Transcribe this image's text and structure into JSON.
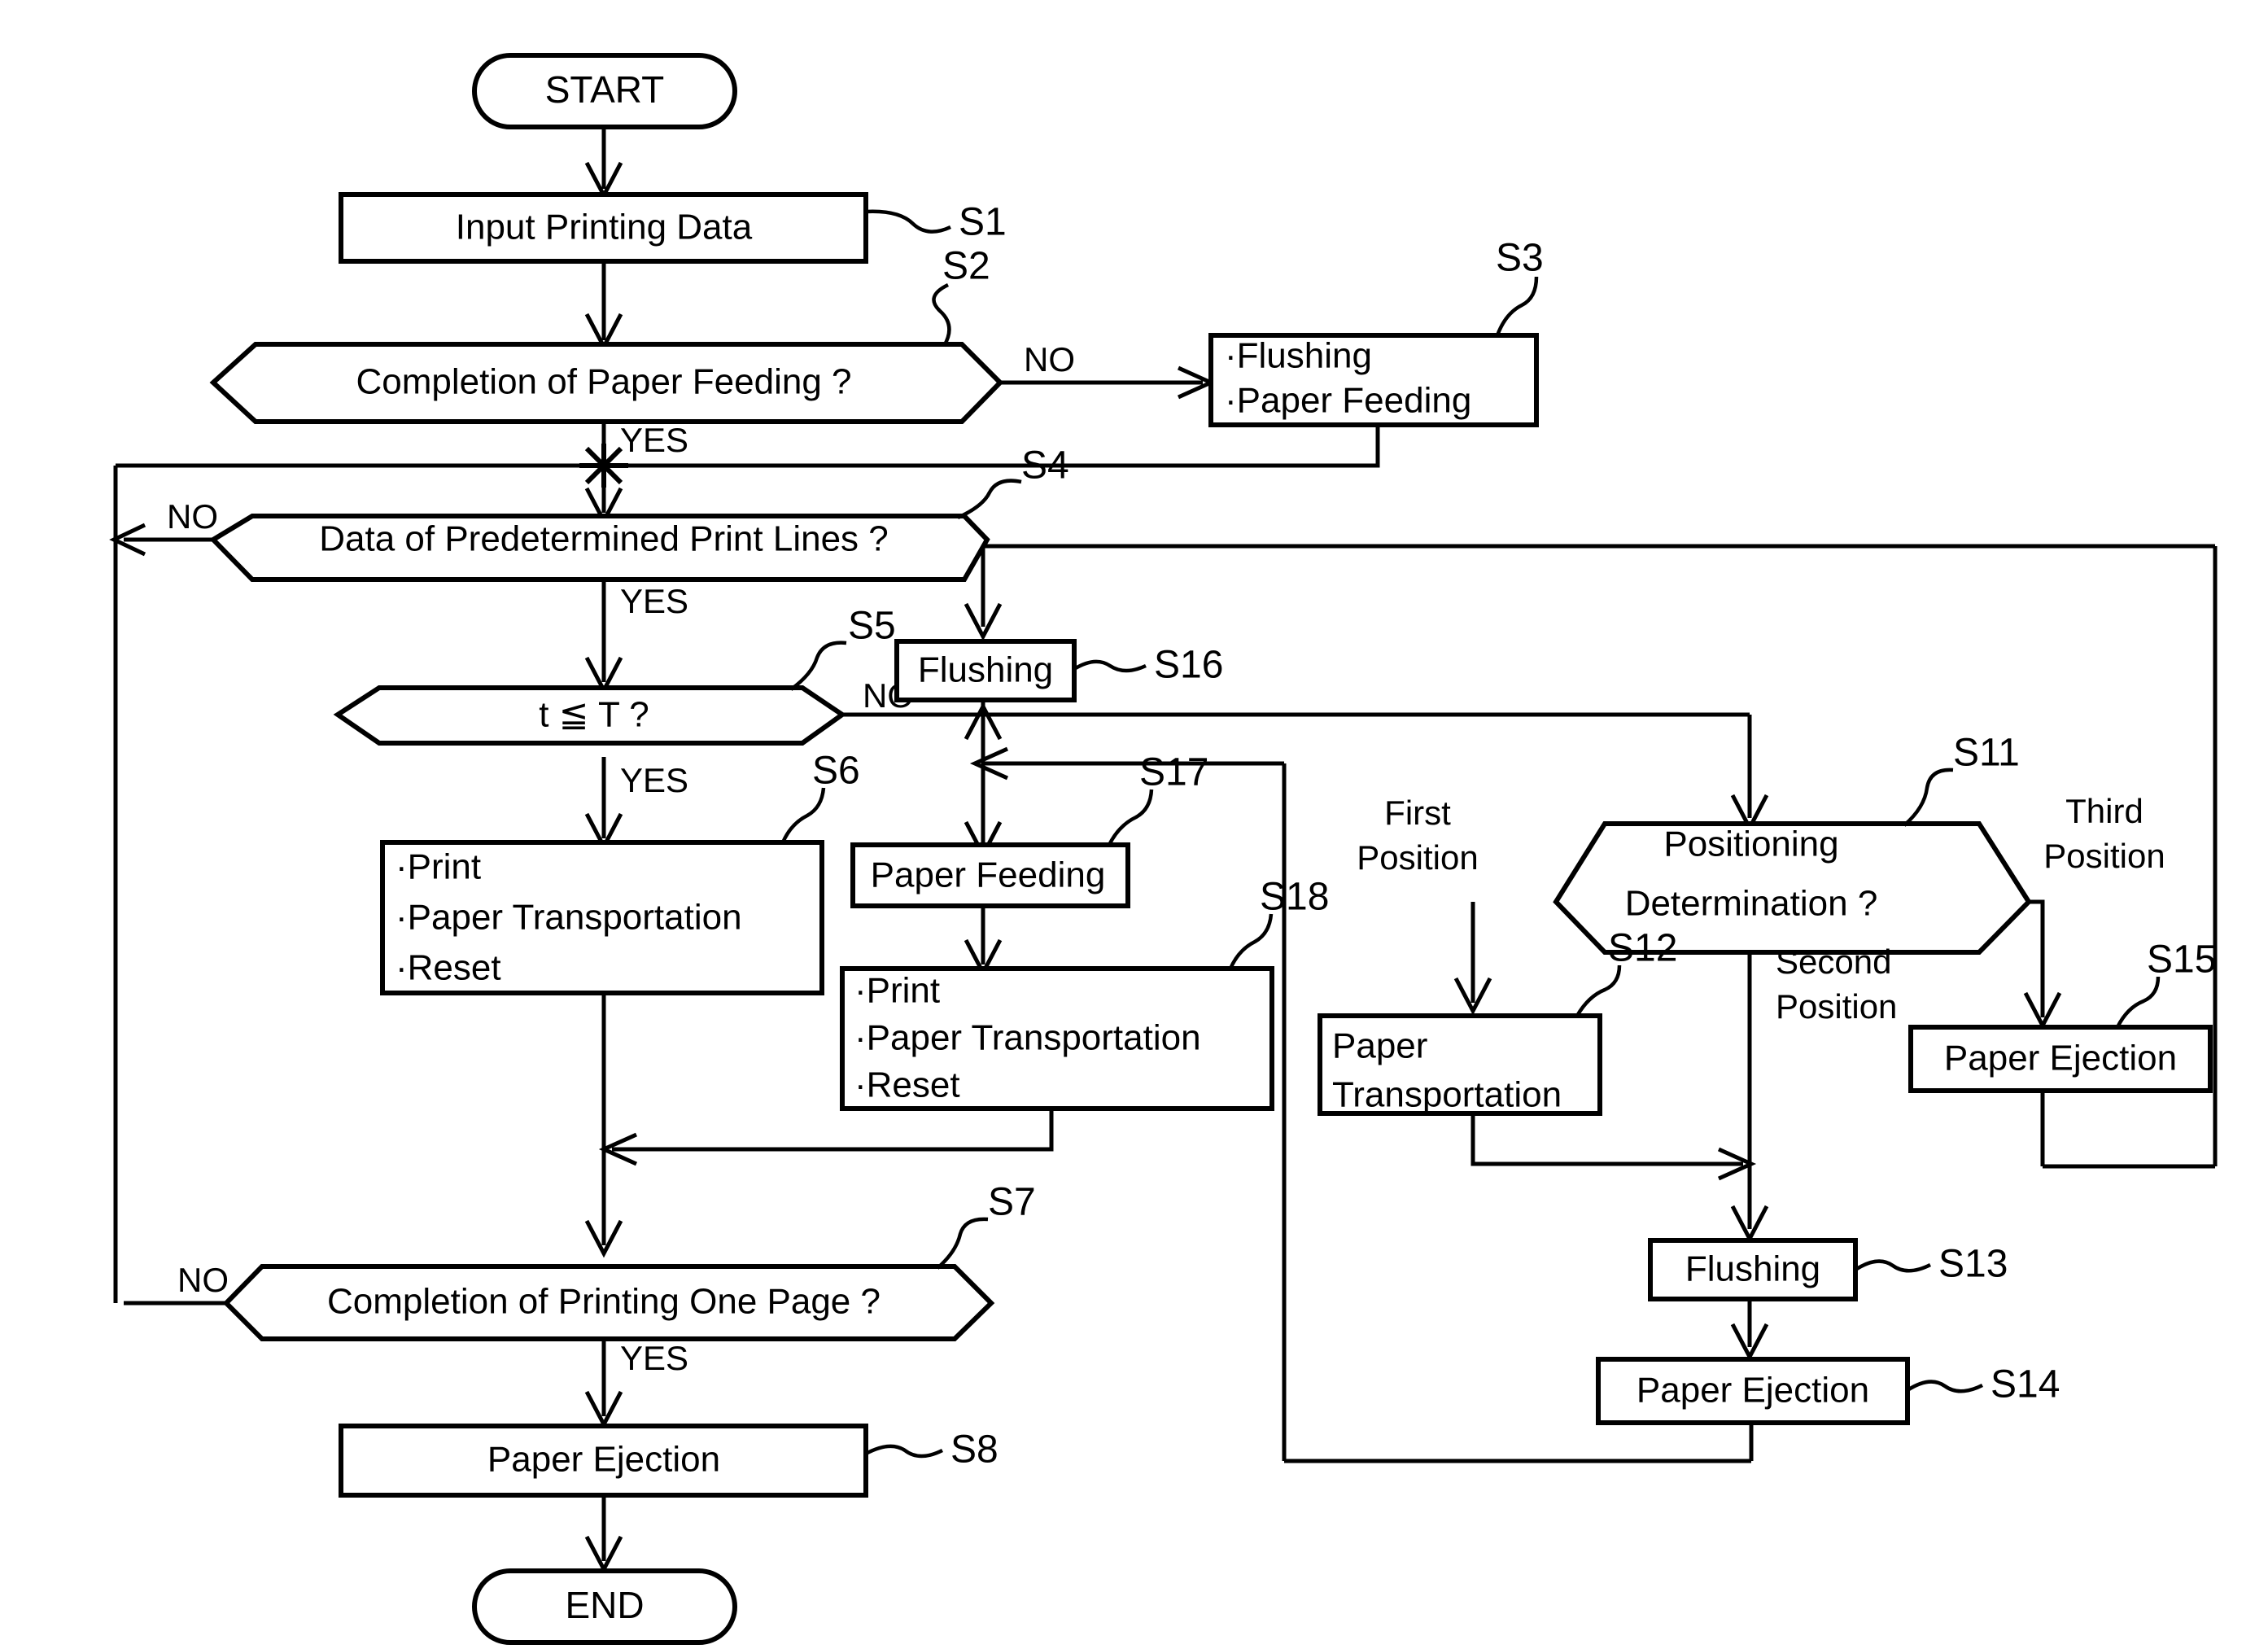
{
  "diagram": {
    "type": "flowchart",
    "title": "",
    "terminators": {
      "start": "START",
      "end": "END"
    },
    "nodes": [
      {
        "id": "S1",
        "ref": "S1",
        "shape": "process",
        "lines": [
          "Input Printing Data"
        ]
      },
      {
        "id": "S2",
        "ref": "S2",
        "shape": "decision",
        "lines": [
          "Completion of Paper Feeding ?"
        ]
      },
      {
        "id": "S3",
        "ref": "S3",
        "shape": "process",
        "lines": [
          "·Flushing",
          "·Paper Feeding"
        ]
      },
      {
        "id": "S4",
        "ref": "S4",
        "shape": "decision",
        "lines": [
          "Data of Predetermined Print Lines ?"
        ]
      },
      {
        "id": "S5",
        "ref": "S5",
        "shape": "decision",
        "lines": [
          "t ≦ T ?"
        ]
      },
      {
        "id": "S6",
        "ref": "S6",
        "shape": "process",
        "lines": [
          "·Print",
          "·Paper Transportation",
          "·Reset"
        ]
      },
      {
        "id": "S7",
        "ref": "S7",
        "shape": "decision",
        "lines": [
          "Completion of Printing One Page ?"
        ]
      },
      {
        "id": "S8",
        "ref": "S8",
        "shape": "process",
        "lines": [
          "Paper Ejection"
        ]
      },
      {
        "id": "S11",
        "ref": "S11",
        "shape": "decision",
        "lines": [
          "Positioning",
          "Determination ?"
        ]
      },
      {
        "id": "S12",
        "ref": "S12",
        "shape": "process",
        "lines": [
          "Paper",
          "Transportation"
        ]
      },
      {
        "id": "S13",
        "ref": "S13",
        "shape": "process",
        "lines": [
          "Flushing"
        ]
      },
      {
        "id": "S14",
        "ref": "S14",
        "shape": "process",
        "lines": [
          "Paper Ejection"
        ]
      },
      {
        "id": "S15",
        "ref": "S15",
        "shape": "process",
        "lines": [
          "Paper Ejection"
        ]
      },
      {
        "id": "S16",
        "ref": "S16",
        "shape": "process",
        "lines": [
          "Flushing"
        ]
      },
      {
        "id": "S17",
        "ref": "S17",
        "shape": "process",
        "lines": [
          "Paper Feeding"
        ]
      },
      {
        "id": "S18",
        "ref": "S18",
        "shape": "process",
        "lines": [
          "·Print",
          "·Paper Transportation",
          "·Reset"
        ]
      }
    ],
    "edge_labels": {
      "s2_no": "NO",
      "s2_yes": "YES",
      "s4_no": "NO",
      "s4_yes": "YES",
      "s5_no": "NO",
      "s5_yes": "YES",
      "s7_no": "NO",
      "s7_yes": "YES",
      "s11_first": "First",
      "s11_first_2": "Position",
      "s11_second": "Second",
      "s11_second_2": "Position",
      "s11_third": "Third",
      "s11_third_2": "Position"
    },
    "step_refs": {
      "s1": "S1",
      "s2": "S2",
      "s3": "S3",
      "s4": "S4",
      "s5": "S5",
      "s6": "S6",
      "s7": "S7",
      "s8": "S8",
      "s11": "S11",
      "s12": "S12",
      "s13": "S13",
      "s14": "S14",
      "s15": "S15",
      "s16": "S16",
      "s17": "S17",
      "s18": "S18"
    },
    "colors": {
      "stroke": "#000000",
      "fill": "#ffffff",
      "background": "#ffffff"
    }
  }
}
